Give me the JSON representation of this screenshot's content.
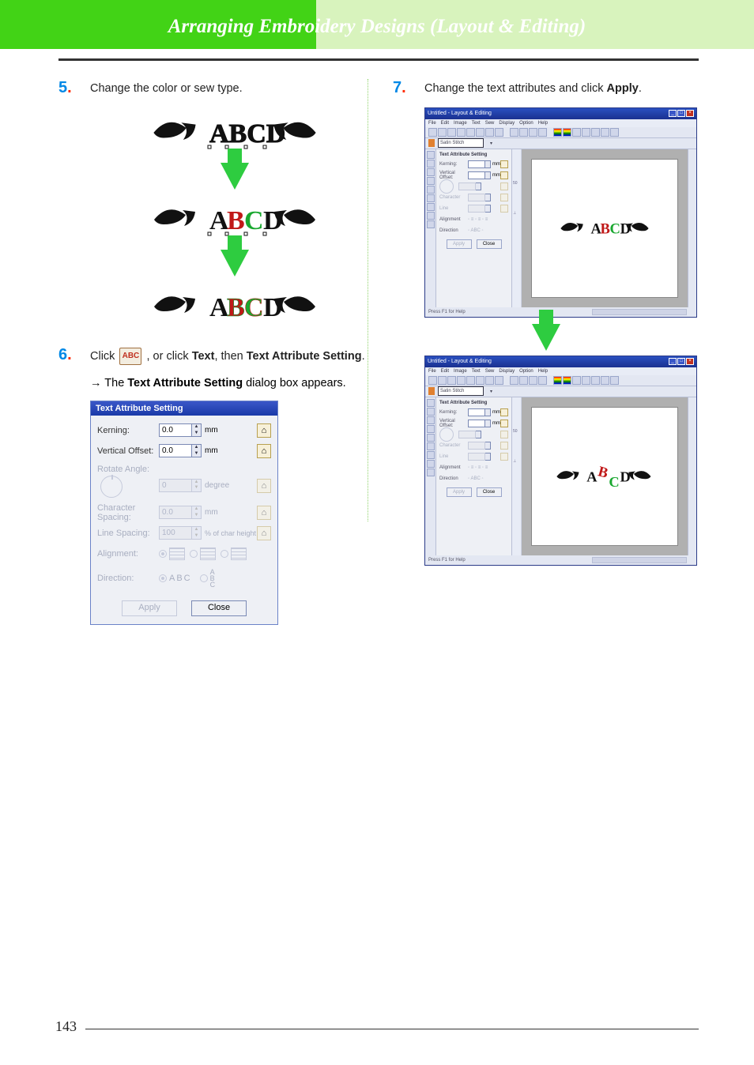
{
  "header": {
    "chapter_title": "Arranging Embroidery Designs (Layout & Editing)"
  },
  "page_number": "143",
  "steps": {
    "s5": {
      "num": "5",
      "text": "Change the color or sew type."
    },
    "s6": {
      "num": "6",
      "text_a": "Click ",
      "abc_btn": "ABC",
      "text_b": " , or click ",
      "bold1": "Text",
      "text_c": ", then ",
      "bold2": "Text Attribute Setting",
      "text_d": ".",
      "sub_arrow": "→",
      "sub_a": " The ",
      "sub_bold": "Text Attribute Setting",
      "sub_b": " dialog box appears."
    },
    "s7": {
      "num": "7",
      "text_a": "Change the text attributes and click ",
      "bold1": "Apply",
      "text_b": "."
    }
  },
  "dialog": {
    "title": "Text Attribute Setting",
    "kerning_label": "Kerning:",
    "kerning_value": "0.0",
    "kerning_unit": "mm",
    "voffset_label": "Vertical Offset:",
    "voffset_value": "0.0",
    "voffset_unit": "mm",
    "rotate_label": "Rotate Angle:",
    "rotate_value": "0",
    "rotate_unit": "degree",
    "charspace_label": "Character Spacing:",
    "charspace_value": "0.0",
    "charspace_unit": "mm",
    "linespace_label": "Line Spacing:",
    "linespace_value": "100",
    "linespace_unit": "% of char height",
    "align_label": "Alignment:",
    "dir_label": "Direction:",
    "dir_h": "ABC",
    "dir_v": "A\nB\nC",
    "apply": "Apply",
    "close": "Close"
  },
  "app": {
    "title": "Untitled - Layout & Editing",
    "menu": [
      "File",
      "Edit",
      "Image",
      "Text",
      "Sew",
      "Display",
      "Option",
      "Help"
    ],
    "tb_paint_label": "Satin Stitch",
    "panel": {
      "kerning_label": "Kerning:",
      "kerning_value": "0.0",
      "kerning_unit": "mm",
      "voffset_label": "Vertical Offset:",
      "voffset_value": "0.0",
      "voffset_unit": "mm",
      "apply": "Apply",
      "close": "Close"
    },
    "status": "Press F1 for Help"
  },
  "embroidery_text": "ABCD"
}
